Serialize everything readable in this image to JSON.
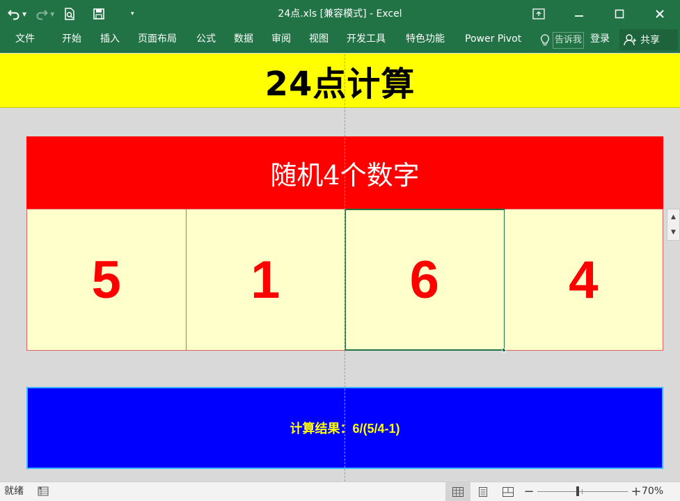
{
  "window": {
    "title": "24点.xls  [兼容模式] - Excel"
  },
  "ribbon": {
    "tabs": [
      "文件",
      "开始",
      "插入",
      "页面布局",
      "公式",
      "数据",
      "审阅",
      "视图",
      "开发工具",
      "特色功能",
      "Power Pivot"
    ],
    "tell_me": "告诉我",
    "login": "登录",
    "share": "共享"
  },
  "sheet": {
    "banner_title": "24点计算",
    "numbers_header": "随机4个数字",
    "numbers": [
      "5",
      "1",
      "6",
      "4"
    ],
    "result_text": "计算结果：6/(5/4-1)"
  },
  "statusbar": {
    "status": "就绪",
    "zoom": "70%",
    "zoom_value": 70
  },
  "colors": {
    "excel_green": "#217346",
    "banner_yellow": "#ffff00",
    "header_red": "#ff0000",
    "cell_fill": "#ffffcc",
    "result_blue": "#0000ff",
    "result_text": "#ffff00"
  },
  "icons": [
    "undo-icon",
    "redo-icon",
    "print-preview-icon",
    "save-icon",
    "customize-qat-icon",
    "ribbon-display-icon",
    "minimize-icon",
    "maximize-icon",
    "close-icon",
    "lightbulb-icon",
    "person-icon",
    "macro-record-icon",
    "normal-view-icon",
    "page-layout-view-icon",
    "page-break-view-icon"
  ]
}
